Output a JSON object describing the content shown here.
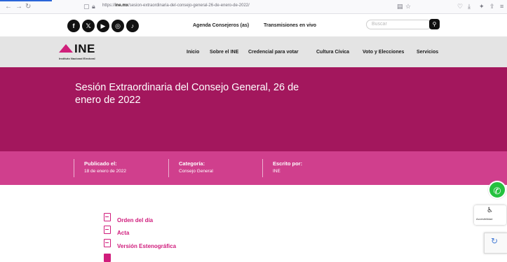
{
  "browser": {
    "url_domain": "ine.mx",
    "url_prefix": "https://",
    "url_path": "/sesion-extraordinaria-del-consejo-general-26-de-enero-de-2022/"
  },
  "topbar": {
    "social": [
      {
        "name": "facebook",
        "glyph": "f"
      },
      {
        "name": "x-twitter",
        "glyph": "𝕏"
      },
      {
        "name": "youtube",
        "glyph": "▶"
      },
      {
        "name": "instagram",
        "glyph": "◎"
      },
      {
        "name": "tiktok",
        "glyph": "♪"
      }
    ],
    "link_consejeros": "Agenda Consejeros (as)",
    "link_transmisiones": "Transmisiones en vivo",
    "search_placeholder": "Buscar"
  },
  "logo": {
    "text": "INE",
    "subtitle": "Instituto Nacional Electoral"
  },
  "nav": {
    "items": [
      "Inicio",
      "Sobre el INE",
      "Credencial para votar",
      "Cultura Cívica",
      "Voto y Elecciones",
      "Servicios"
    ]
  },
  "hero": {
    "title": "Sesión Extraordinaria del Consejo General, 26 de enero de 2022"
  },
  "meta": {
    "published_label": "Publicado el:",
    "published_value": "18 de enero de 2022",
    "category_label": "Categoría:",
    "category_value": "Consejo General",
    "author_label": "Escrito por:",
    "author_value": "INE"
  },
  "documents": [
    {
      "label": "Orden del día"
    },
    {
      "label": "Acta"
    },
    {
      "label": "Versión Estenográfica"
    }
  ],
  "widgets": {
    "accessibility_label": "Accesibilidad"
  },
  "colors": {
    "brand_magenta": "#a3175d",
    "meta_pink": "#d03f8d",
    "link_pink": "#d01c7c",
    "whatsapp_green": "#25c13f"
  }
}
